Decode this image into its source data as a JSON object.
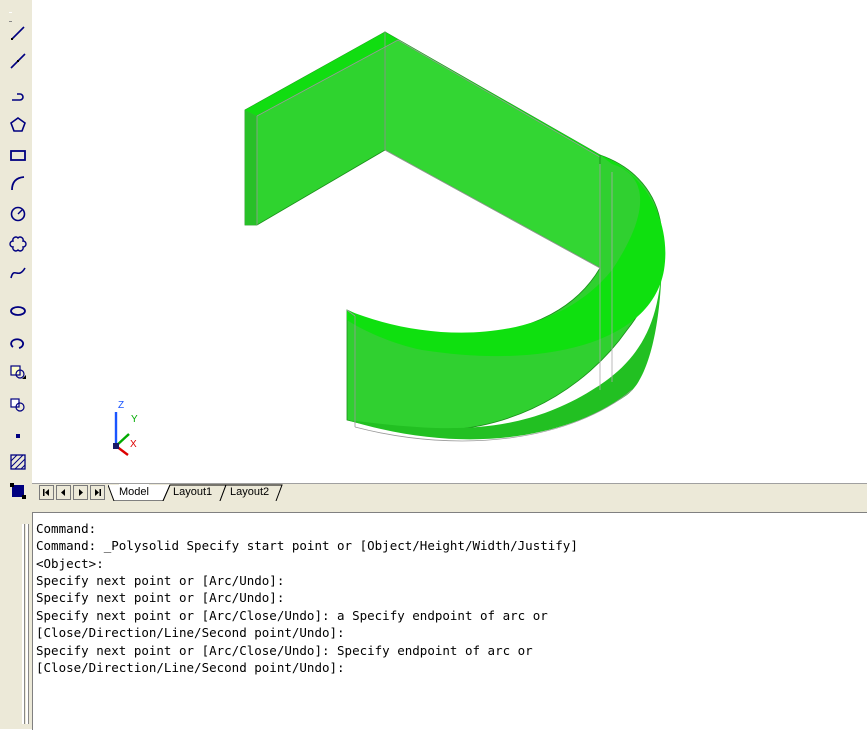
{
  "toolbar": {
    "tools": [
      {
        "name": "line-icon"
      },
      {
        "name": "construction-line-icon"
      },
      {
        "name": "polyline-icon"
      },
      {
        "name": "polygon-icon"
      },
      {
        "name": "rectangle-icon"
      },
      {
        "name": "arc-icon"
      },
      {
        "name": "circle-icon"
      },
      {
        "name": "revision-cloud-icon"
      },
      {
        "name": "spline-icon"
      },
      {
        "name": "ellipse-icon"
      },
      {
        "name": "ellipse-arc-icon"
      },
      {
        "name": "insert-block-icon"
      },
      {
        "name": "make-block-icon"
      },
      {
        "name": "point-icon"
      },
      {
        "name": "hatch-icon"
      },
      {
        "name": "region-icon"
      }
    ]
  },
  "ucs": {
    "z_label": "Z",
    "y_label": "Y",
    "x_label": "X"
  },
  "tabs": {
    "items": [
      {
        "label": "Model",
        "active": true
      },
      {
        "label": "Layout1",
        "active": false
      },
      {
        "label": "Layout2",
        "active": false
      }
    ]
  },
  "model": {
    "solid_color": "#22cc22"
  },
  "command": {
    "lines": [
      "Command:",
      "Command: _Polysolid Specify start point or [Object/Height/Width/Justify]",
      "<Object>:",
      "Specify next point or [Arc/Undo]:",
      "Specify next point or [Arc/Undo]:",
      "Specify next point or [Arc/Close/Undo]: a Specify endpoint of arc or",
      "[Close/Direction/Line/Second point/Undo]:",
      "Specify next point or [Arc/Close/Undo]: Specify endpoint of arc or",
      "[Close/Direction/Line/Second point/Undo]:"
    ]
  }
}
